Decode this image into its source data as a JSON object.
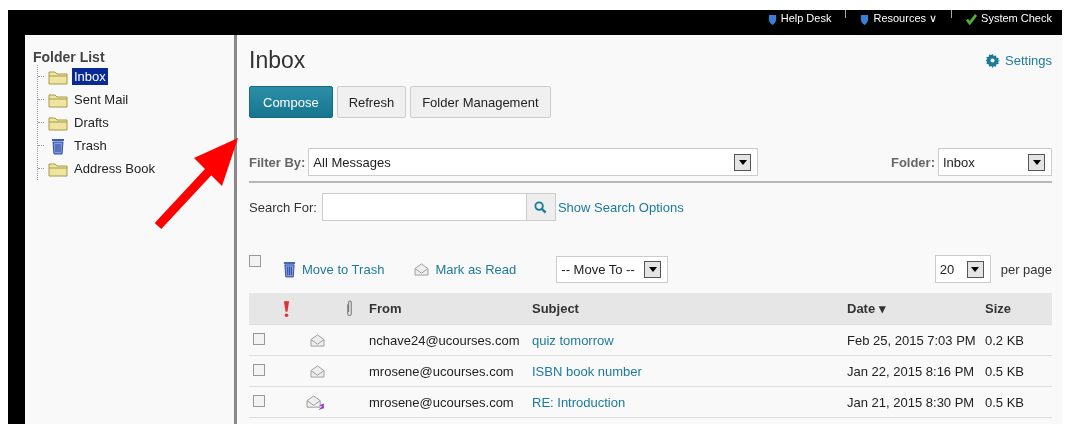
{
  "top_links": [
    {
      "label": "Help Desk",
      "kind": "info"
    },
    {
      "label": "Resources ∨",
      "kind": "info"
    },
    {
      "label": "System Check",
      "kind": "check"
    }
  ],
  "sidebar": {
    "title": "Folder List",
    "items": [
      {
        "label": "Inbox",
        "kind": "folder",
        "selected": true
      },
      {
        "label": "Sent Mail",
        "kind": "folder",
        "selected": false
      },
      {
        "label": "Drafts",
        "kind": "folder",
        "selected": false
      },
      {
        "label": "Trash",
        "kind": "trash",
        "selected": false
      },
      {
        "label": "Address Book",
        "kind": "folder",
        "selected": false
      }
    ]
  },
  "main": {
    "title": "Inbox",
    "settings": "Settings",
    "buttons": [
      {
        "label": "Compose",
        "primary": true
      },
      {
        "label": "Refresh",
        "primary": false
      },
      {
        "label": "Folder Management",
        "primary": false
      }
    ],
    "filter": {
      "label": "Filter By:",
      "value": "All Messages"
    },
    "folder": {
      "label": "Folder:",
      "value": "Inbox"
    },
    "search": {
      "label": "Search For:",
      "options": "Show Search Options"
    },
    "toolbar": {
      "select_all": false,
      "move_to_trash": "Move to Trash",
      "mark_as_read": "Mark as Read",
      "move_to": "-- Move To --",
      "page_size": "20",
      "per_page": "per page"
    },
    "table": {
      "columns": [
        "From",
        "Subject",
        "Date ▾",
        "Size"
      ],
      "rows": [
        {
          "checked": false,
          "kind": "read",
          "from": "nchave24@ucourses.com",
          "subject": "quiz tomorrow",
          "date": "Feb 25, 2015 7:03 PM",
          "size": "0.2 KB"
        },
        {
          "checked": false,
          "kind": "read",
          "from": "mrosene@ucourses.com",
          "subject": "ISBN book number",
          "date": "Jan 22, 2015 8:16 PM",
          "size": "0.5 KB"
        },
        {
          "checked": false,
          "kind": "replied",
          "from": "mrosene@ucourses.com",
          "subject": "RE: Introduction",
          "date": "Jan 21, 2015 8:30 PM",
          "size": "0.5 KB"
        }
      ]
    }
  },
  "annotation": {
    "kind": "arrow"
  }
}
